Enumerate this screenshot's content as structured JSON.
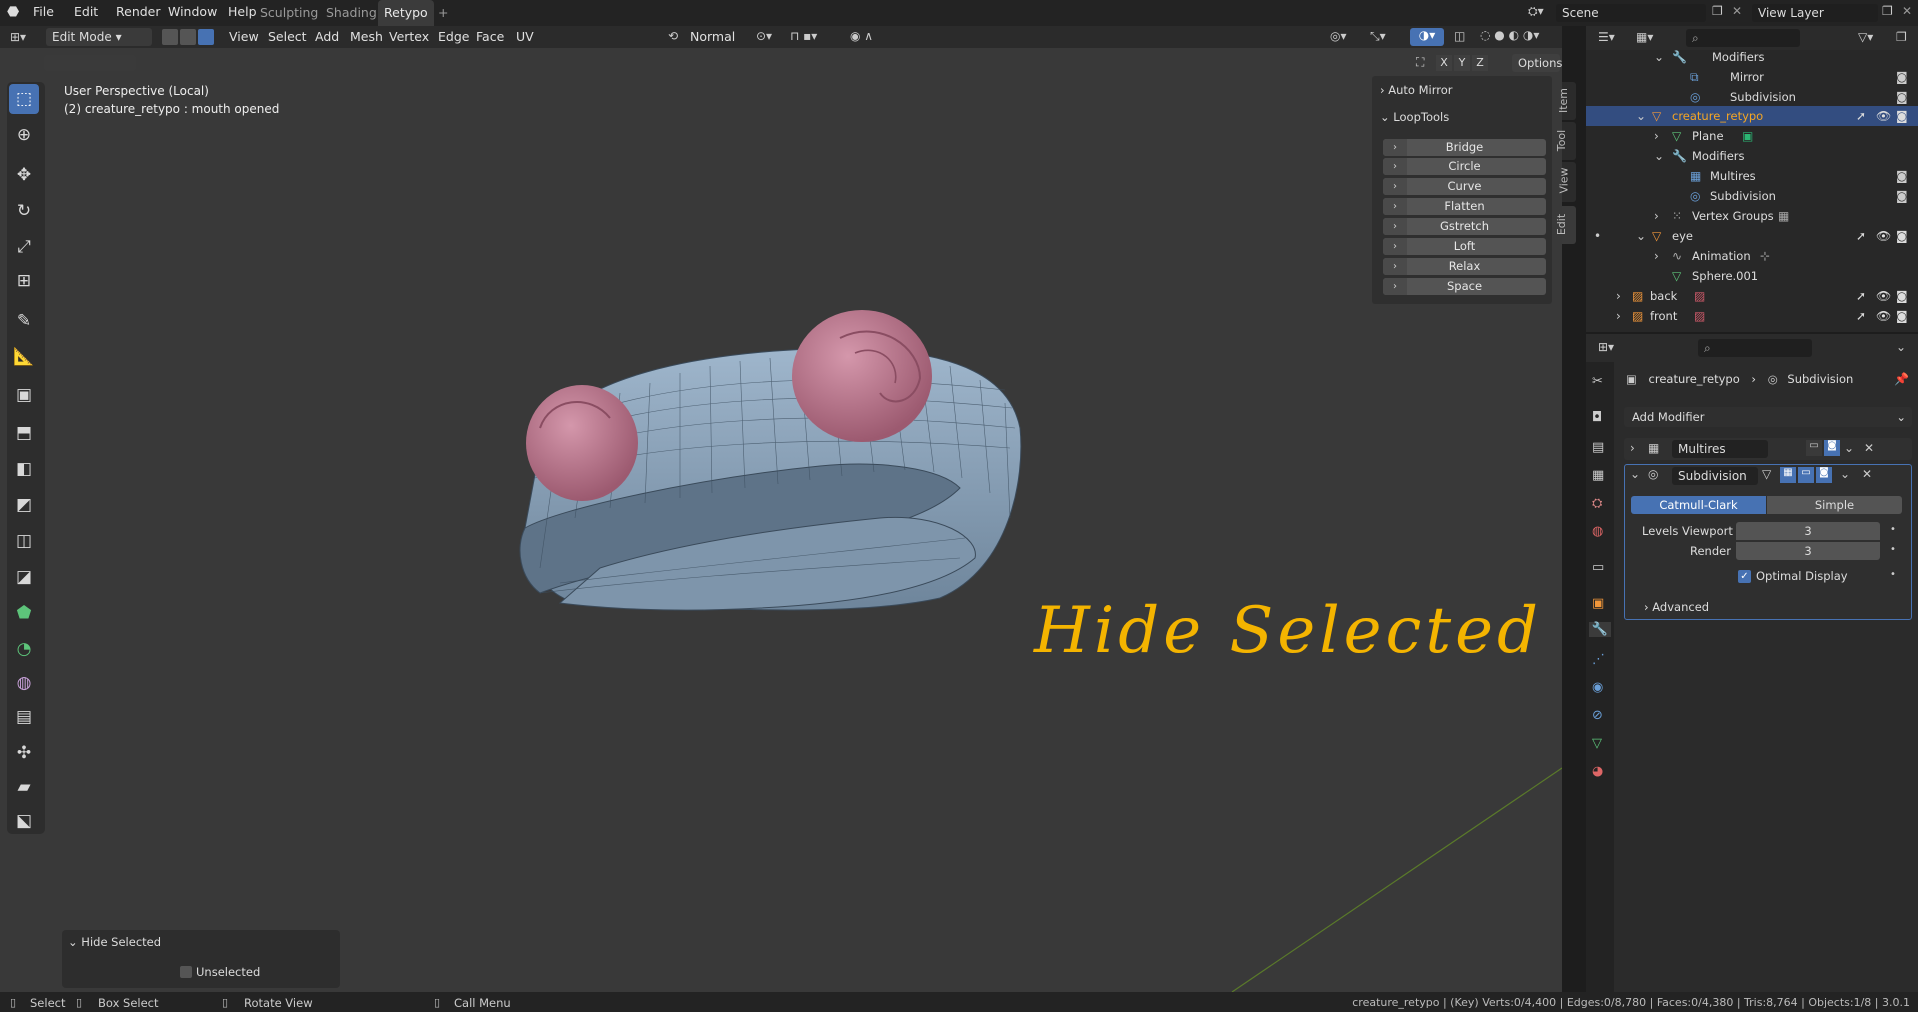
{
  "topbar": {
    "menus": [
      "File",
      "Edit",
      "Render",
      "Window",
      "Help"
    ],
    "workspaces": [
      "Sculpting",
      "Shading",
      "Retypo",
      "+"
    ],
    "active_workspace": "Retypo",
    "scene": "Scene",
    "view_layer": "View Layer"
  },
  "header": {
    "mode": "Edit Mode",
    "menus": [
      "View",
      "Select",
      "Add",
      "Mesh",
      "Vertex",
      "Edge",
      "Face",
      "UV"
    ],
    "orientation": "Normal",
    "axes": [
      "X",
      "Y",
      "Z"
    ],
    "options": "Options"
  },
  "viewport": {
    "perspective": "User Perspective (Local)",
    "object_info": "(2) creature_retypo : mouth opened",
    "annotation": "Hide Selected"
  },
  "npanel": {
    "auto_mirror": "Auto Mirror",
    "looptools": "LoopTools",
    "buttons": [
      "Bridge",
      "Circle",
      "Curve",
      "Flatten",
      "Gstretch",
      "Loft",
      "Relax",
      "Space"
    ],
    "tabs": [
      "Item",
      "Tool",
      "View",
      "Edit"
    ]
  },
  "outliner": {
    "rows": [
      {
        "label": "Modifiers",
        "indent": 2
      },
      {
        "label": "Mirror",
        "indent": 3
      },
      {
        "label": "Subdivision",
        "indent": 3
      },
      {
        "label": "creature_retypo",
        "indent": 1,
        "selected": true
      },
      {
        "label": "Plane",
        "indent": 2
      },
      {
        "label": "Modifiers",
        "indent": 2
      },
      {
        "label": "Multires",
        "indent": 3
      },
      {
        "label": "Subdivision",
        "indent": 3
      },
      {
        "label": "Vertex Groups",
        "indent": 2
      },
      {
        "label": "eye",
        "indent": 1
      },
      {
        "label": "Animation",
        "indent": 2
      },
      {
        "label": "Sphere.001",
        "indent": 2
      },
      {
        "label": "back",
        "indent": 0
      },
      {
        "label": "front",
        "indent": 0
      }
    ]
  },
  "properties": {
    "breadcrumb_object": "creature_retypo",
    "breadcrumb_modifier": "Subdivision",
    "add_modifier": "Add Modifier",
    "multires_name": "Multires",
    "subdiv_name": "Subdivision",
    "catmull": "Catmull-Clark",
    "simple": "Simple",
    "levels_viewport_label": "Levels Viewport",
    "levels_viewport": "3",
    "render_label": "Render",
    "render": "3",
    "optimal_display": "Optimal Display",
    "advanced": "Advanced"
  },
  "last_op": {
    "title": "Hide Selected",
    "unselected": "Unselected"
  },
  "status": {
    "select": "Select",
    "box_select": "Box Select",
    "rotate_view": "Rotate View",
    "call_menu": "Call Menu",
    "stats": "creature_retypo | (Key) Verts:0/4,400 | Edges:0/8,780 | Faces:0/4,380 | Tris:8,764 | Objects:1/8 | 3.0.1"
  },
  "colors": {
    "accent": "#4772b3",
    "mesh": "#8aa4bd",
    "eye": "#c17d95",
    "annotation": "#f4b400"
  }
}
